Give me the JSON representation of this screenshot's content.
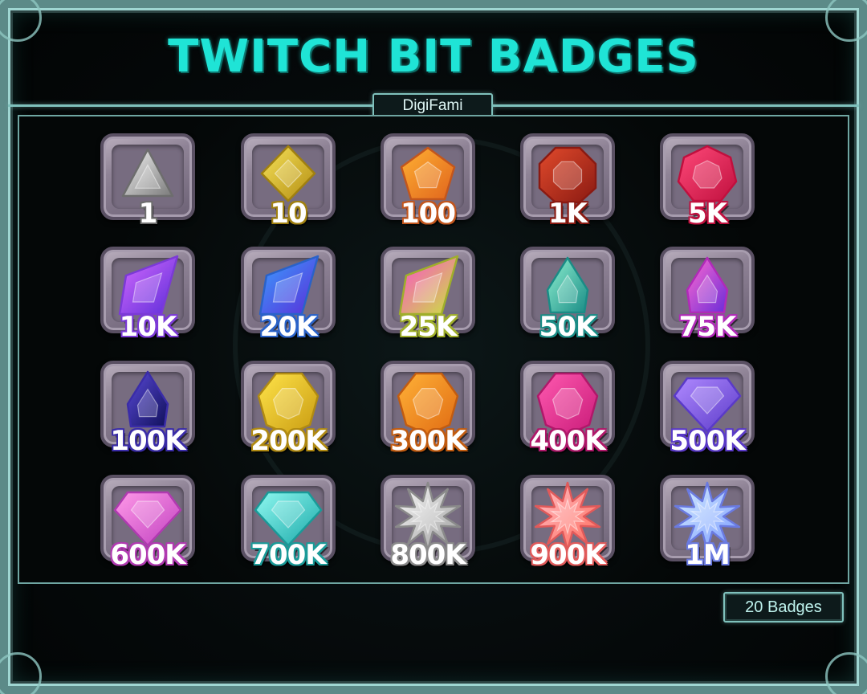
{
  "title": "TWITCH BIT BADGES",
  "brand": "DigiFami",
  "count_label": "20 Badges",
  "badges": [
    {
      "label": "1",
      "shape": "triangle",
      "colors": [
        "#f4f4f4",
        "#7a7a7a"
      ],
      "outline": "#6d6d6d",
      "icon": "triangle-gem-icon"
    },
    {
      "label": "10",
      "shape": "diamond",
      "colors": [
        "#f6e25a",
        "#b38d12"
      ],
      "outline": "#a08010",
      "icon": "diamond-gem-icon"
    },
    {
      "label": "100",
      "shape": "pentagon",
      "colors": [
        "#ffb234",
        "#e0641c"
      ],
      "outline": "#c2561d",
      "icon": "pentagon-gem-icon"
    },
    {
      "label": "1K",
      "shape": "octagon",
      "colors": [
        "#e14a2c",
        "#8a1a12"
      ],
      "outline": "#8a1a12",
      "icon": "octagon-gem-icon"
    },
    {
      "label": "5K",
      "shape": "heptagon",
      "colors": [
        "#ff4a7a",
        "#c0103e"
      ],
      "outline": "#c0103e",
      "icon": "heptagon-gem-icon"
    },
    {
      "label": "10K",
      "shape": "shard",
      "colors": [
        "#d76bff",
        "#5a2cd8"
      ],
      "outline": "#7b3ad6",
      "icon": "shard-gem-icon"
    },
    {
      "label": "20K",
      "shape": "shard",
      "colors": [
        "#3aa0ff",
        "#5a2cd8"
      ],
      "outline": "#2a62c8",
      "icon": "shard-gem-icon"
    },
    {
      "label": "25K",
      "shape": "shard",
      "colors": [
        "#ff4ad0",
        "#c8e83a"
      ],
      "outline": "#9fae2a",
      "icon": "shard-gem-icon"
    },
    {
      "label": "50K",
      "shape": "teardrop",
      "colors": [
        "#8ff0d0",
        "#1a8c86"
      ],
      "outline": "#1a8c86",
      "icon": "teardrop-gem-icon"
    },
    {
      "label": "75K",
      "shape": "teardrop",
      "colors": [
        "#ff6ad0",
        "#6a2cd8"
      ],
      "outline": "#b02ab8",
      "icon": "teardrop-gem-icon"
    },
    {
      "label": "100K",
      "shape": "teardrop",
      "colors": [
        "#5a4ad8",
        "#10105a"
      ],
      "outline": "#3a2ca8",
      "icon": "teardrop-gem-icon"
    },
    {
      "label": "200K",
      "shape": "polyhedron",
      "colors": [
        "#ffe44a",
        "#c89a10"
      ],
      "outline": "#b08a12",
      "icon": "polyhedron-gem-icon"
    },
    {
      "label": "300K",
      "shape": "polyhedron",
      "colors": [
        "#ffb238",
        "#e06a12"
      ],
      "outline": "#c25c10",
      "icon": "polyhedron-gem-icon"
    },
    {
      "label": "400K",
      "shape": "polyhedron",
      "colors": [
        "#ff5ab0",
        "#c81a78"
      ],
      "outline": "#b0186a",
      "icon": "polyhedron-gem-icon"
    },
    {
      "label": "500K",
      "shape": "brilliant",
      "colors": [
        "#b08aff",
        "#5a3ac8"
      ],
      "outline": "#5a3ac8",
      "icon": "brilliant-gem-icon"
    },
    {
      "label": "600K",
      "shape": "brilliant",
      "colors": [
        "#ff9ae8",
        "#c040c0"
      ],
      "outline": "#b03ab0",
      "icon": "brilliant-gem-icon"
    },
    {
      "label": "700K",
      "shape": "brilliant",
      "colors": [
        "#8ff8f0",
        "#1aa8a8"
      ],
      "outline": "#1a9a98",
      "icon": "brilliant-gem-icon"
    },
    {
      "label": "800K",
      "shape": "star",
      "colors": [
        "#ffffff",
        "#9a9a9a"
      ],
      "outline": "#8a8a8a",
      "icon": "star-gem-icon"
    },
    {
      "label": "900K",
      "shape": "star",
      "colors": [
        "#ffc0c8",
        "#ff6a5a"
      ],
      "outline": "#e05a5a",
      "icon": "star-gem-icon"
    },
    {
      "label": "1M",
      "shape": "star",
      "colors": [
        "#d8f0ff",
        "#7a9aff"
      ],
      "outline": "#6a7ae0",
      "icon": "star-gem-icon"
    }
  ]
}
